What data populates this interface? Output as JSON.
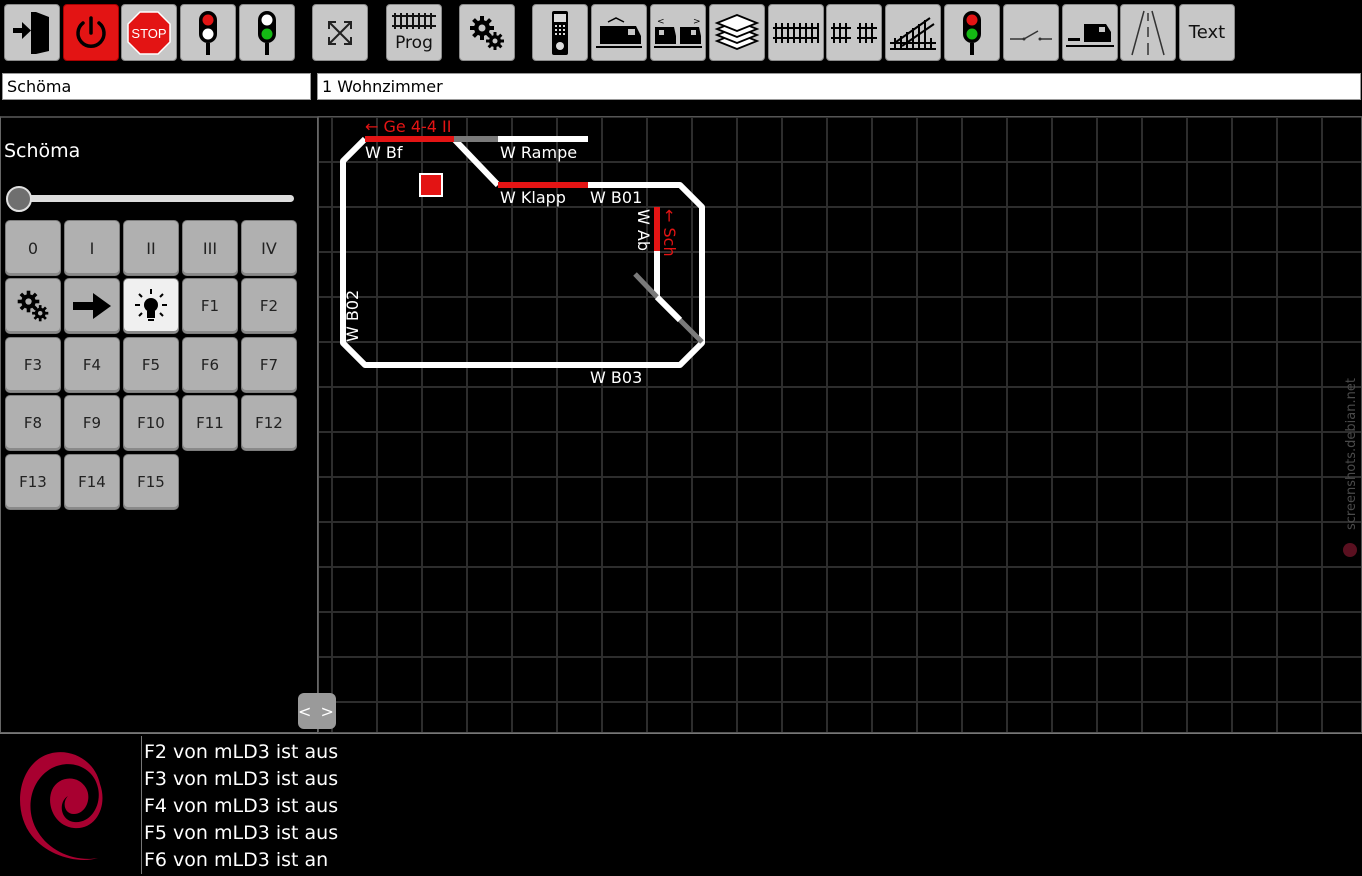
{
  "toolbar": {
    "prog_label": "Prog",
    "text_label": "Text",
    "stop_label": "STOP",
    "buttons": [
      {
        "name": "exit-button",
        "icon": "exit-door-icon"
      },
      {
        "name": "power-button",
        "icon": "power-icon",
        "state": "active"
      },
      {
        "name": "stop-button",
        "icon": "stop-sign-icon"
      },
      {
        "name": "signal-red-button",
        "icon": "signal-red-icon"
      },
      {
        "name": "signal-green-button",
        "icon": "signal-green-icon"
      },
      {
        "name": "fullscreen-button",
        "icon": "expand-icon"
      },
      {
        "name": "prog-button",
        "icon": "track-icon"
      },
      {
        "name": "settings-button",
        "icon": "gears-icon"
      },
      {
        "name": "controller-button",
        "icon": "handheld-controller-icon"
      },
      {
        "name": "locos-button",
        "icon": "locomotive-icon"
      },
      {
        "name": "multiple-units-button",
        "icon": "multiple-locomotives-icon"
      },
      {
        "name": "layers-button",
        "icon": "layers-icon"
      },
      {
        "name": "tracks-button",
        "icon": "track-straight-icon"
      },
      {
        "name": "feedback-tracks-button",
        "icon": "track-sections-icon"
      },
      {
        "name": "switches-button",
        "icon": "track-switch-icon"
      },
      {
        "name": "signals-button",
        "icon": "signal-icon"
      },
      {
        "name": "accessories-button",
        "icon": "accessory-icon"
      },
      {
        "name": "routes-button",
        "icon": "route-locomotive-icon"
      },
      {
        "name": "streets-button",
        "icon": "road-icon"
      },
      {
        "name": "text-button",
        "icon": "text-icon"
      }
    ]
  },
  "fields": {
    "loco_name": "Schöma",
    "layer_name": "1 Wohnzimmer"
  },
  "loco_panel": {
    "title": "Schöma",
    "speed": 0,
    "gear_buttons": [
      "0",
      "I",
      "II",
      "III",
      "IV"
    ],
    "function_buttons": [
      "F1",
      "F2",
      "F3",
      "F4",
      "F5",
      "F6",
      "F7",
      "F8",
      "F9",
      "F10",
      "F11",
      "F12",
      "F13",
      "F14",
      "F15"
    ],
    "special_buttons": [
      {
        "name": "loco-settings-button",
        "icon": "gears-icon"
      },
      {
        "name": "direction-button",
        "icon": "arrow-right-icon"
      },
      {
        "name": "light-button",
        "icon": "light-bulb-icon",
        "state": "on"
      }
    ]
  },
  "layout": {
    "labels": {
      "train_ge": "← Ge 4-4 II",
      "w_bf": "W Bf",
      "w_rampe": "W Rampe",
      "w_klapp": "W Klapp",
      "w_b01": "W B01",
      "w_ab": "W Ab",
      "train_sch": "← Sch",
      "w_b02": "W B02",
      "w_b03": "W B03"
    },
    "colors": {
      "track": "#ffffff",
      "occupied": "#e31414",
      "inactive": "#7a7a7a"
    },
    "toggle_label": "< >",
    "watermark": "screenshots.debian.net"
  },
  "log": {
    "logo": "debian-swirl-logo",
    "lines": [
      "F2 von mLD3 ist aus",
      "F3 von mLD3 ist aus",
      "F4 von mLD3 ist aus",
      "F5 von mLD3 ist aus",
      "F6 von mLD3 ist an"
    ]
  }
}
